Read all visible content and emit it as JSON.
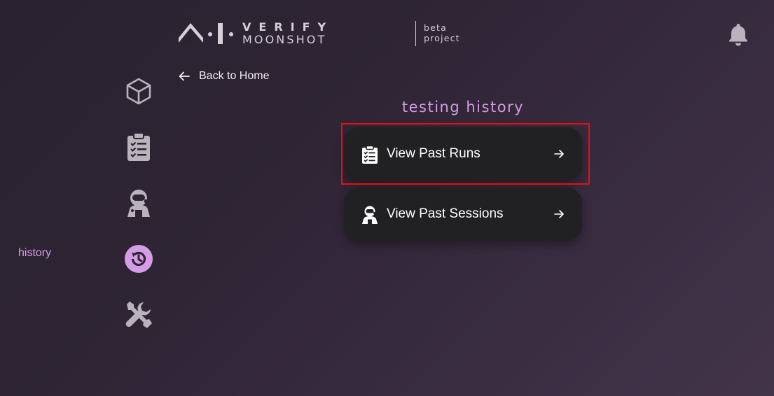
{
  "header": {
    "logo_verify": "VERIFY",
    "logo_moonshot": "MOONSHOT",
    "logo_beta": "beta",
    "logo_project": "project",
    "notifications_icon": "bell-icon"
  },
  "nav": {
    "items": [
      {
        "icon": "cube-icon"
      },
      {
        "icon": "clipboard-icon"
      },
      {
        "icon": "astronaut-icon"
      },
      {
        "icon": "history-icon",
        "active": true,
        "label": "history"
      },
      {
        "icon": "tools-icon"
      }
    ],
    "active_label": "history",
    "active_color": "#d59ce6",
    "inactive_color": "#b8b3bc"
  },
  "back_link": {
    "label": "Back to Home",
    "icon": "arrow-left-icon"
  },
  "main": {
    "title": "testing history",
    "cards": [
      {
        "label": "View Past Runs",
        "icon": "clipboard-icon",
        "arrow": "arrow-right-icon"
      },
      {
        "label": "View Past Sessions",
        "icon": "astronaut-icon",
        "arrow": "arrow-right-icon"
      }
    ]
  }
}
